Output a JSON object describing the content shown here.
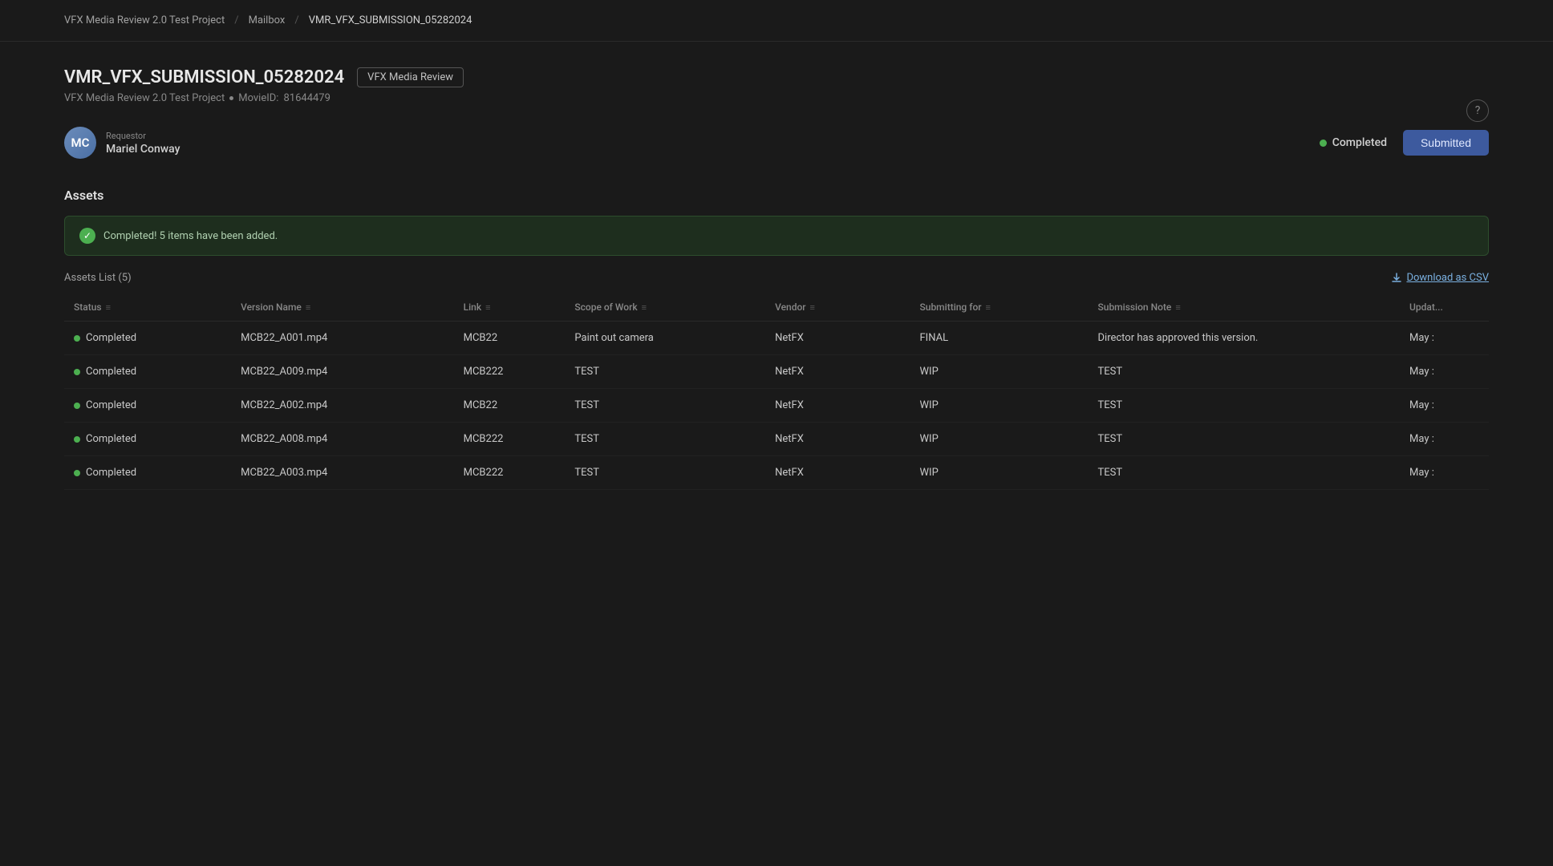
{
  "breadcrumb": {
    "items": [
      {
        "label": "VFX Media Review 2.0 Test Project",
        "active": false
      },
      {
        "label": "Mailbox",
        "active": false
      },
      {
        "label": "VMR_VFX_SUBMISSION_05282024",
        "active": true
      }
    ],
    "separators": [
      "/",
      "/"
    ]
  },
  "page": {
    "title": "VMR_VFX_SUBMISSION_05282024",
    "tag": "VFX Media Review",
    "meta_project": "VFX Media Review 2.0 Test Project",
    "meta_movie_id_label": "MovieID:",
    "meta_movie_id": "81644479"
  },
  "requester": {
    "label": "Requestor",
    "name": "Mariel Conway",
    "initials": "MC"
  },
  "status": {
    "completed_label": "Completed",
    "submitted_label": "Submitted"
  },
  "assets": {
    "section_title": "Assets",
    "success_message": "Completed! 5 items have been added.",
    "list_label": "Assets List (5)",
    "download_csv": "Download as CSV",
    "columns": [
      {
        "key": "status",
        "label": "Status"
      },
      {
        "key": "version_name",
        "label": "Version Name"
      },
      {
        "key": "link",
        "label": "Link"
      },
      {
        "key": "scope_of_work",
        "label": "Scope of Work"
      },
      {
        "key": "vendor",
        "label": "Vendor"
      },
      {
        "key": "submitting_for",
        "label": "Submitting for"
      },
      {
        "key": "submission_note",
        "label": "Submission Note"
      },
      {
        "key": "updated",
        "label": "Updat..."
      }
    ],
    "rows": [
      {
        "status": "Completed",
        "version_name": "MCB22_A001.mp4",
        "link": "MCB22",
        "scope_of_work": "Paint out camera",
        "vendor": "NetFX",
        "submitting_for": "FINAL",
        "submission_note": "Director has approved this version.",
        "updated": "May :"
      },
      {
        "status": "Completed",
        "version_name": "MCB22_A009.mp4",
        "link": "MCB222",
        "scope_of_work": "TEST",
        "vendor": "NetFX",
        "submitting_for": "WIP",
        "submission_note": "TEST",
        "updated": "May :"
      },
      {
        "status": "Completed",
        "version_name": "MCB22_A002.mp4",
        "link": "MCB22",
        "scope_of_work": "TEST",
        "vendor": "NetFX",
        "submitting_for": "WIP",
        "submission_note": "TEST",
        "updated": "May :"
      },
      {
        "status": "Completed",
        "version_name": "MCB22_A008.mp4",
        "link": "MCB222",
        "scope_of_work": "TEST",
        "vendor": "NetFX",
        "submitting_for": "WIP",
        "submission_note": "TEST",
        "updated": "May :"
      },
      {
        "status": "Completed",
        "version_name": "MCB22_A003.mp4",
        "link": "MCB222",
        "scope_of_work": "TEST",
        "vendor": "NetFX",
        "submitting_for": "WIP",
        "submission_note": "TEST",
        "updated": "May :"
      }
    ]
  },
  "icons": {
    "help": "?",
    "check": "✓",
    "download": "⬇",
    "sort": "≡"
  }
}
